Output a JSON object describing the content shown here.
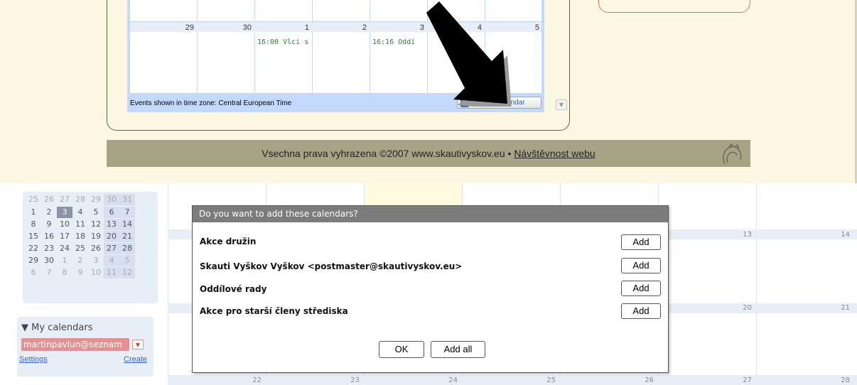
{
  "site": {
    "embedded_calendar": {
      "day_numbers": [
        "29",
        "30",
        "1",
        "2",
        "3",
        "4",
        "5"
      ],
      "events": [
        "16:00 Vlci s",
        "16:16 Oddí"
      ],
      "timezone_text": "Events shown in time zone: Central European Time",
      "gcal_button": {
        "letters": [
          "G",
          "o",
          "o",
          "g",
          "l",
          "e"
        ],
        "suffix": " Calendar",
        "icon": "plus-icon"
      }
    },
    "footer": {
      "text": "Vsechna prava vyhrazena ©2007 www.skautivyskov.eu • ",
      "link": "Návštěvnost webu",
      "logo_icon": "lily-logo-icon"
    },
    "annotation_arrow_icon": "black-arrow-icon"
  },
  "sidebar": {
    "mini_calendar": [
      [
        "25",
        "26",
        "27",
        "28",
        "29",
        "30",
        "31"
      ],
      [
        "1",
        "2",
        "3",
        "4",
        "5",
        "6",
        "7"
      ],
      [
        "8",
        "9",
        "10",
        "11",
        "12",
        "13",
        "14"
      ],
      [
        "15",
        "16",
        "17",
        "18",
        "19",
        "20",
        "21"
      ],
      [
        "22",
        "23",
        "24",
        "25",
        "26",
        "27",
        "28"
      ],
      [
        "29",
        "30",
        "1",
        "2",
        "3",
        "4",
        "5"
      ],
      [
        "6",
        "7",
        "8",
        "9",
        "10",
        "11",
        "12"
      ]
    ],
    "my_calendars_label": "My calendars",
    "user_calendar": "martinpavlun@seznam",
    "settings_link": "Settings",
    "create_link": "Create"
  },
  "grid": {
    "week2_numbers": [
      "13",
      "14"
    ],
    "week3_numbers": [
      "20",
      "21"
    ],
    "week4_numbers": [
      "22",
      "23",
      "24",
      "25",
      "26",
      "27",
      "28"
    ]
  },
  "dialog": {
    "title": "Do you want to add these calendars?",
    "calendars": [
      "Akce družin",
      "Skauti Vyškov Vyškov <postmaster@skautivyskov.eu>",
      "Oddílové rady",
      "Akce pro starší členy střediska"
    ],
    "add_label": "Add",
    "ok_label": "OK",
    "add_all_label": "Add all"
  }
}
